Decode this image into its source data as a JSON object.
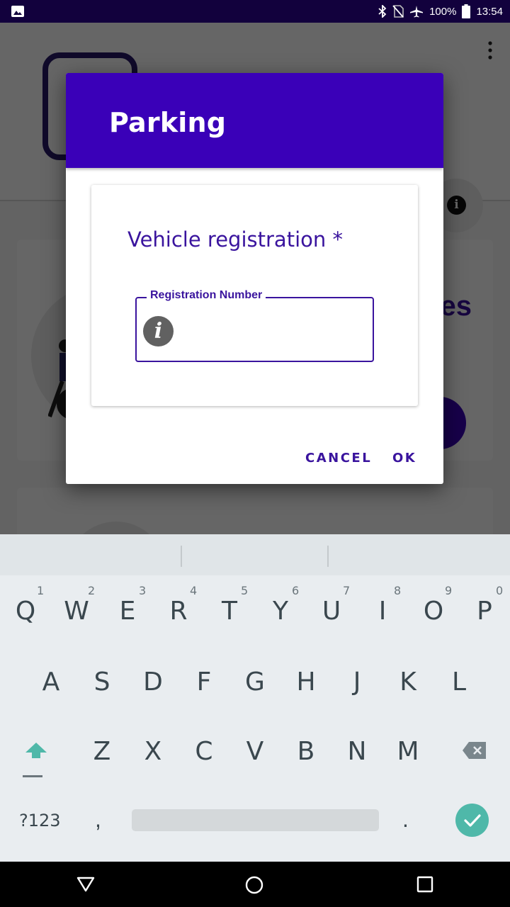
{
  "status_bar": {
    "battery_percent": "100%",
    "time": "13:54",
    "icons": [
      "image-icon",
      "bluetooth-icon",
      "no-sim-icon",
      "airplane-icon",
      "battery-icon"
    ]
  },
  "background_app": {
    "card_title_fragment": "es"
  },
  "dialog": {
    "title": "Parking",
    "field_heading": "Vehicle registration *",
    "field_label": "Registration Number",
    "field_value": "",
    "cancel_label": "CANCEL",
    "ok_label": "OK"
  },
  "keyboard": {
    "row1": [
      {
        "key": "Q",
        "hint": "1"
      },
      {
        "key": "W",
        "hint": "2"
      },
      {
        "key": "E",
        "hint": "3"
      },
      {
        "key": "R",
        "hint": "4"
      },
      {
        "key": "T",
        "hint": "5"
      },
      {
        "key": "Y",
        "hint": "6"
      },
      {
        "key": "U",
        "hint": "7"
      },
      {
        "key": "I",
        "hint": "8"
      },
      {
        "key": "O",
        "hint": "9"
      },
      {
        "key": "P",
        "hint": "0"
      }
    ],
    "row2": [
      "A",
      "S",
      "D",
      "F",
      "G",
      "H",
      "J",
      "K",
      "L"
    ],
    "row3": [
      "Z",
      "X",
      "C",
      "V",
      "B",
      "N",
      "M"
    ],
    "symbols_label": "?123",
    "comma": ",",
    "period": "."
  },
  "colors": {
    "status_bar": "#12013d",
    "dialog_header": "#3a00b8",
    "accent_text": "#3a149e",
    "enter_key": "#4fb8a9"
  }
}
